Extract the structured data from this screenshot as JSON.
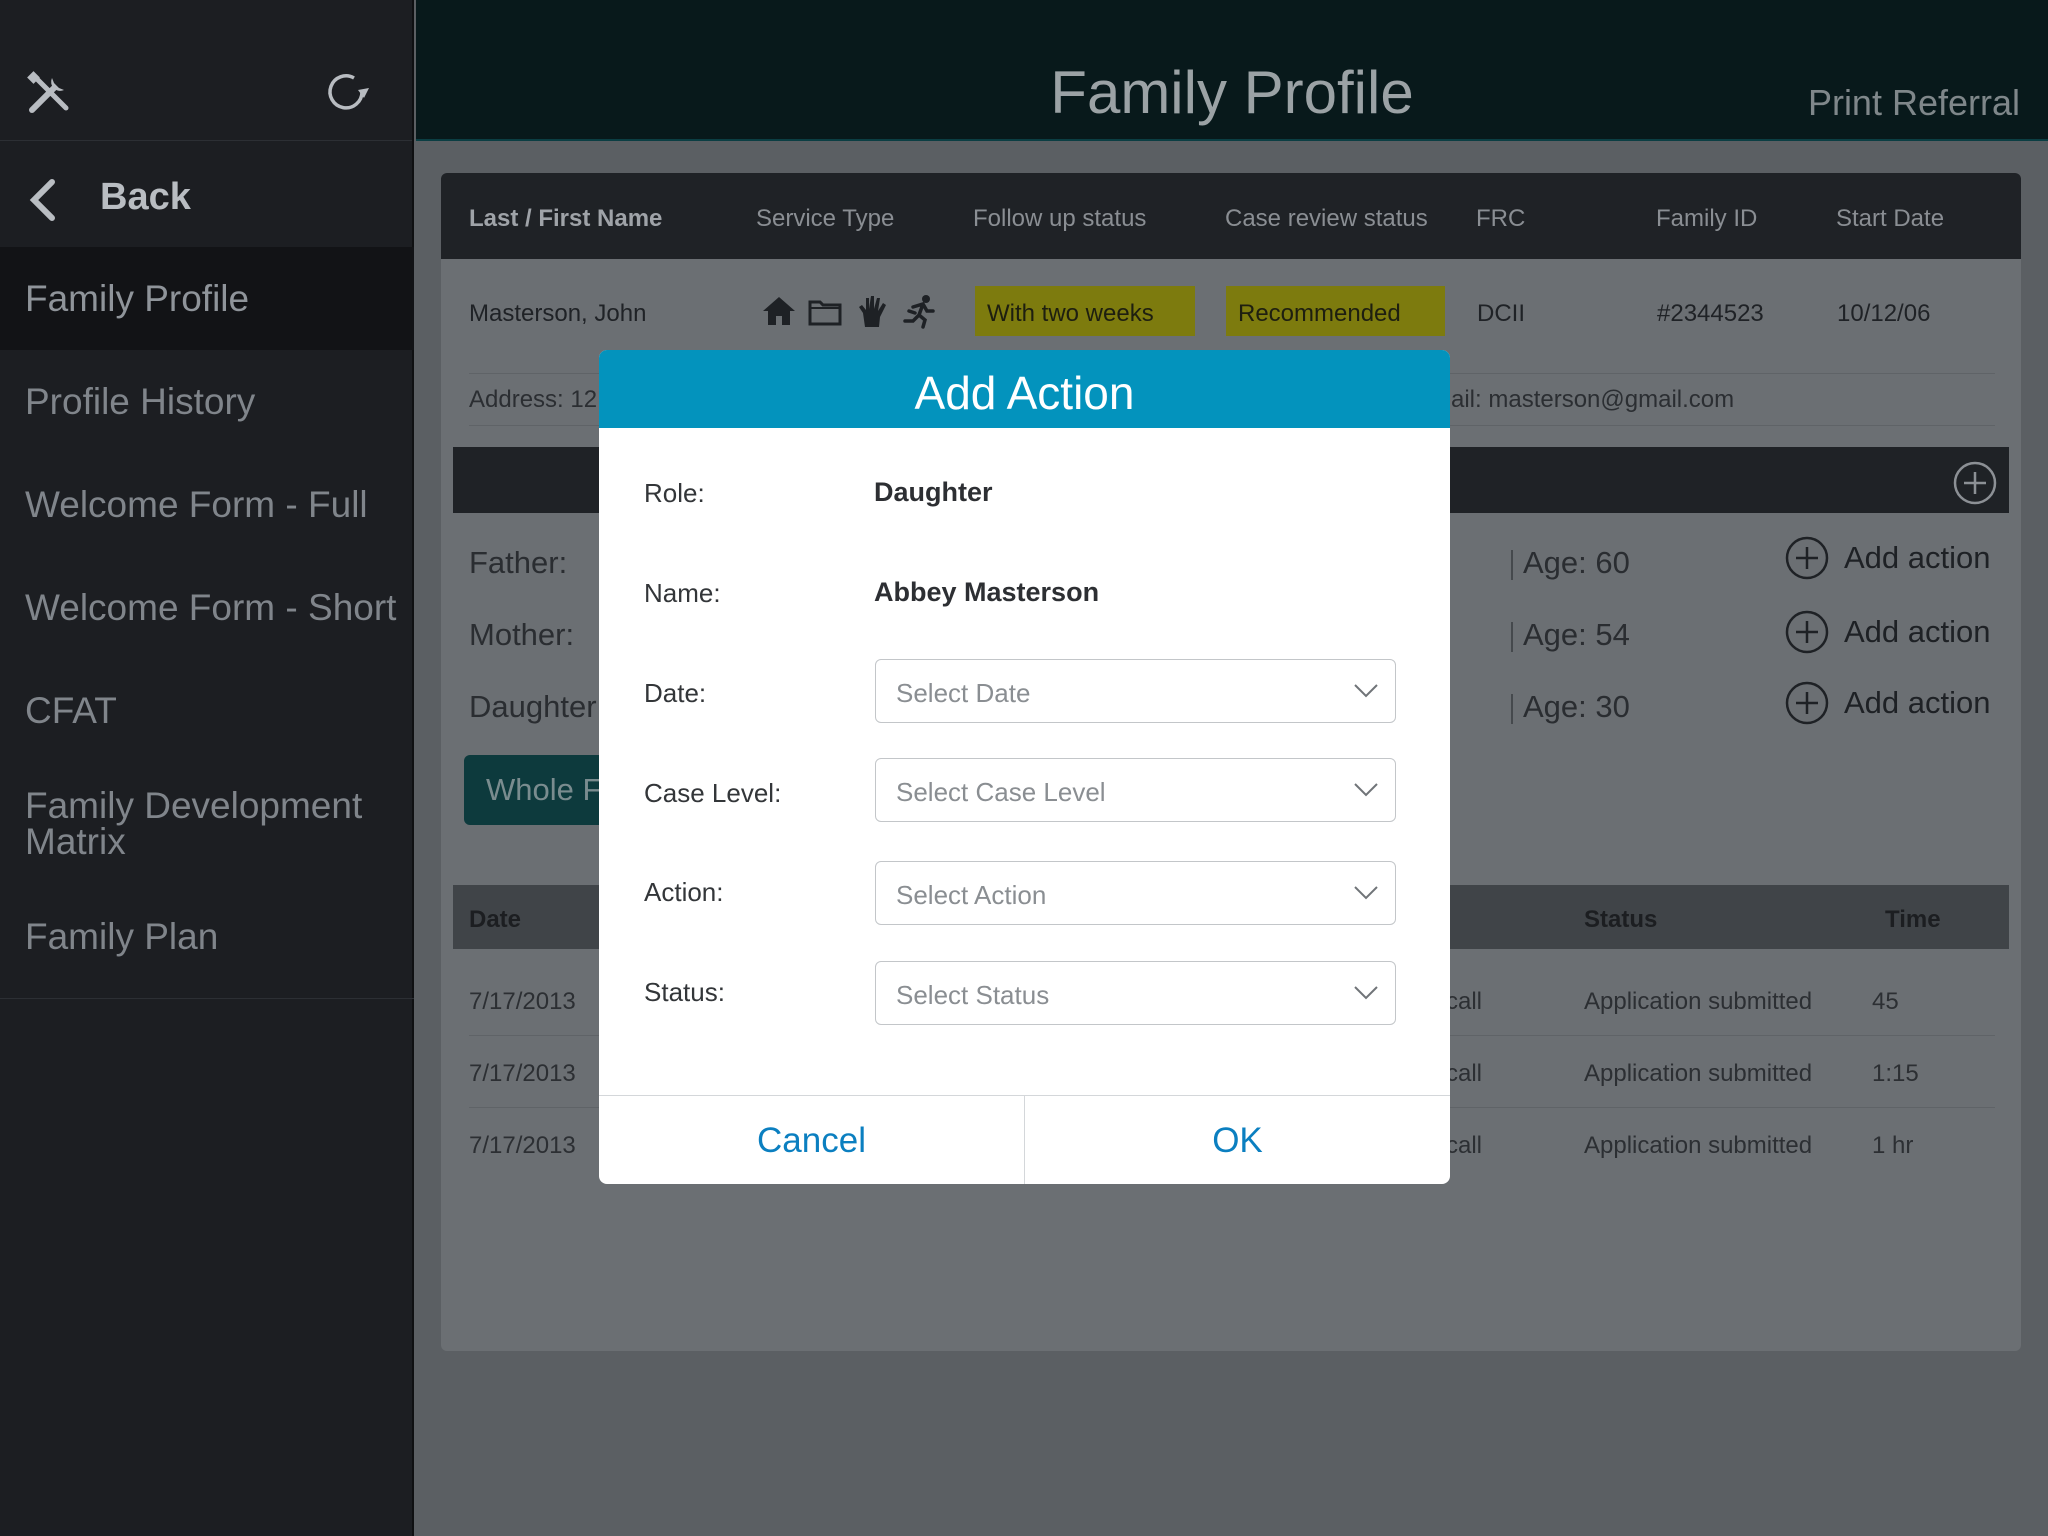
{
  "sidebar": {
    "back_label": "Back",
    "items": [
      {
        "label": "Family Profile",
        "active": true
      },
      {
        "label": "Profile History"
      },
      {
        "label": "Welcome Form - Full"
      },
      {
        "label": "Welcome Form - Short"
      },
      {
        "label": "CFAT"
      },
      {
        "label": "Family Development Matrix"
      },
      {
        "label": "Family Plan"
      }
    ]
  },
  "header": {
    "title": "Family Profile",
    "print_referral": "Print Referral"
  },
  "family_table": {
    "columns": [
      "Last / First Name",
      "Service Type",
      "Follow up status",
      "Case review status",
      "FRC",
      "Family ID",
      "Start Date"
    ],
    "row": {
      "name": "Masterson, John",
      "service_icons": [
        "home-icon",
        "folder-icon",
        "hand-icon",
        "running-person-icon"
      ],
      "follow_up_status": "With two weeks",
      "case_review_status": "Recommended",
      "frc": "DCII",
      "family_id": "#2344523",
      "start_date": "10/12/06"
    },
    "address_partial": "Address: 12",
    "email_partial": "ail: masterson@gmail.com"
  },
  "members": [
    {
      "role": "Father:",
      "age": "Age: 60",
      "action": "Add action"
    },
    {
      "role": "Mother:",
      "age": "Age: 54",
      "action": "Add action"
    },
    {
      "role": "Daughter:",
      "age": "Age: 30",
      "action": "Add action"
    }
  ],
  "whole_family_button": "Whole Fa",
  "history": {
    "columns": {
      "date": "Date",
      "status": "Status",
      "time": "Time"
    },
    "rows": [
      {
        "date": "7/17/2013",
        "type_partial": "call",
        "status": "Application submitted",
        "time": "45"
      },
      {
        "date": "7/17/2013",
        "type_partial": "call",
        "status": "Application submitted",
        "time": "1:15"
      },
      {
        "date": "7/17/2013",
        "type_partial": "call",
        "status": "Application submitted",
        "time": "1 hr"
      }
    ]
  },
  "modal": {
    "title": "Add Action",
    "role_label": "Role:",
    "role_value": "Daughter",
    "name_label": "Name:",
    "name_value": "Abbey Masterson",
    "date_label": "Date:",
    "date_placeholder": "Select Date",
    "case_level_label": "Case Level:",
    "case_level_placeholder": "Select Case Level",
    "action_label": "Action:",
    "action_placeholder": "Select Action",
    "status_label": "Status:",
    "status_placeholder": "Select Status",
    "cancel": "Cancel",
    "ok": "OK"
  },
  "colors": {
    "modal_header": "#0393bd",
    "button_text": "#0b7fc0",
    "badge": "#7d7b0e",
    "app_header": "#08191b"
  }
}
